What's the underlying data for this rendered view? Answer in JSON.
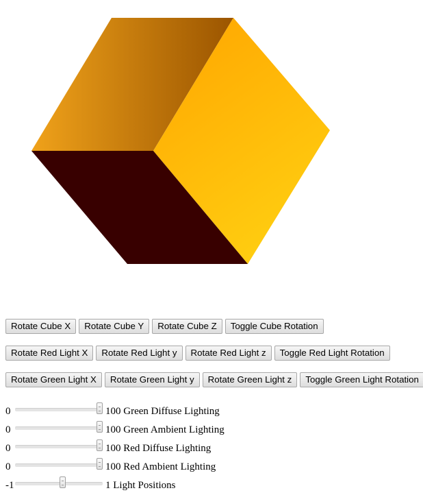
{
  "colors": {
    "cube_left_light": "#f0a21a",
    "cube_left_dark": "#9b5500",
    "cube_right_light": "#ffa500",
    "cube_right_bright": "#ffcc10",
    "cube_bottom": "#380000"
  },
  "button_rows": [
    {
      "id": "cube",
      "buttons": [
        "Rotate Cube X",
        "Rotate Cube Y",
        "Rotate Cube Z",
        "Toggle Cube Rotation"
      ]
    },
    {
      "id": "red-light",
      "buttons": [
        "Rotate Red Light X",
        "Rotate Red Light y",
        "Rotate Red Light z",
        "Toggle Red Light Rotation"
      ]
    },
    {
      "id": "green-light",
      "buttons": [
        "Rotate Green Light X",
        "Rotate Green Light y",
        "Rotate Green Light z",
        "Toggle Green Light Rotation"
      ]
    }
  ],
  "sliders": [
    {
      "id": "green-diffuse",
      "min": "0",
      "max_label": "100 Green Diffuse Lighting",
      "value_fraction": 1.0
    },
    {
      "id": "green-ambient",
      "min": "0",
      "max_label": "100 Green Ambient Lighting",
      "value_fraction": 1.0
    },
    {
      "id": "red-diffuse",
      "min": "0",
      "max_label": "100 Red Diffuse Lighting",
      "value_fraction": 1.0
    },
    {
      "id": "red-ambient",
      "min": "0",
      "max_label": "100 Red Ambient Lighting",
      "value_fraction": 1.0
    },
    {
      "id": "light-positions",
      "min": "-1",
      "max_label": "1 Light Positions",
      "value_fraction": 0.55
    }
  ]
}
